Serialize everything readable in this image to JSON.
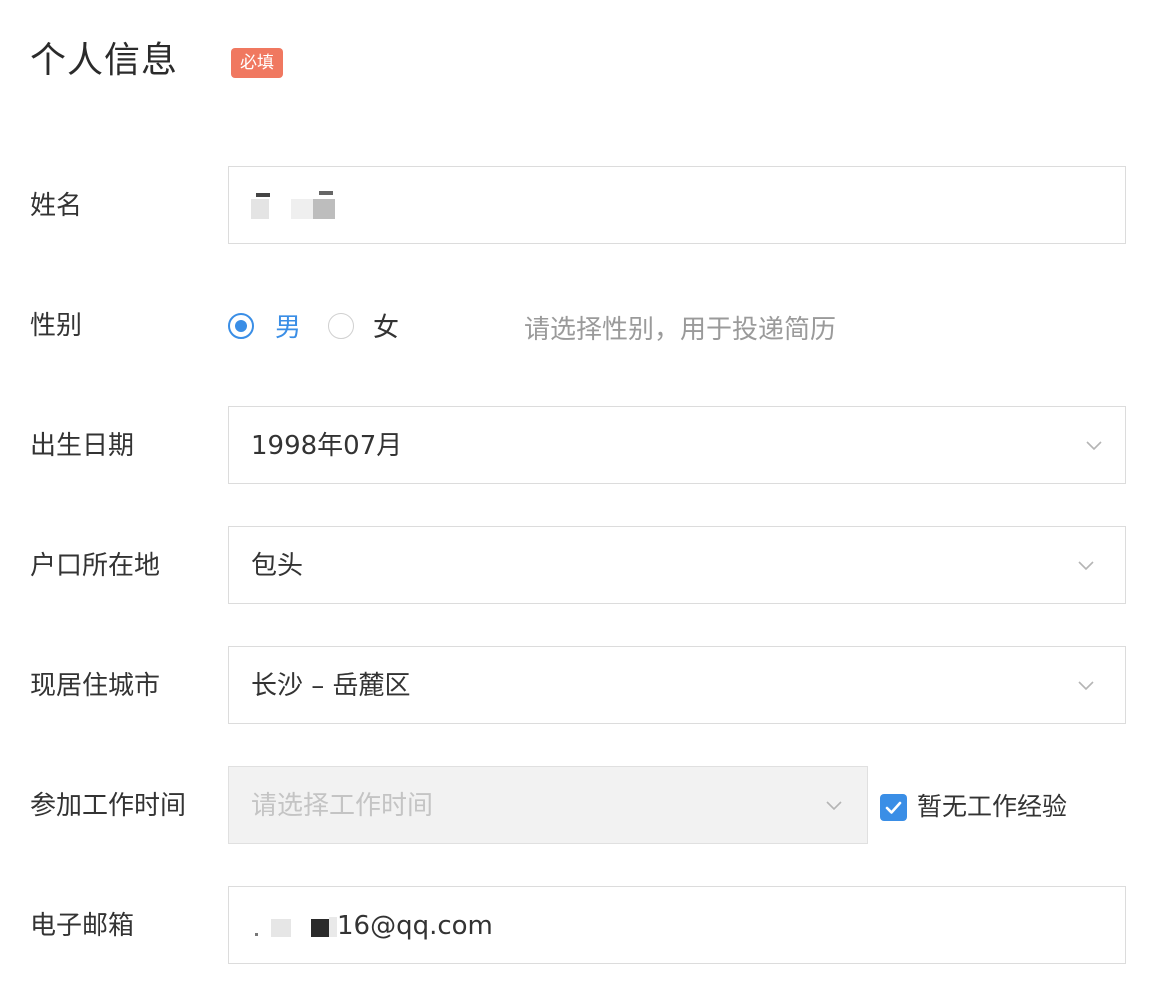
{
  "section": {
    "title": "个人信息",
    "required_badge": "必填"
  },
  "fields": {
    "name": {
      "label": "姓名",
      "value": ""
    },
    "gender": {
      "label": "性别",
      "options": [
        "男",
        "女"
      ],
      "selected": "男",
      "hint": "请选择性别，用于投递简历"
    },
    "birth_date": {
      "label": "出生日期",
      "value": "1998年07月"
    },
    "hukou": {
      "label": "户口所在地",
      "value": "包头"
    },
    "current_city": {
      "label": "现居住城市",
      "value": "长沙 – 岳麓区"
    },
    "work_start": {
      "label": "参加工作时间",
      "placeholder": "请选择工作时间",
      "disabled": true,
      "no_experience_label": "暂无工作经验",
      "no_experience_checked": true
    },
    "email": {
      "label": "电子邮箱",
      "value_suffix": "16@qq.com"
    }
  },
  "colors": {
    "accent": "#3a8ee6",
    "badge": "#f07860",
    "hint": "#9a9a9a",
    "disabled_bg": "#f2f2f2"
  },
  "icons": {
    "dropdown": "chevron-down-icon",
    "checkbox": "checkmark-icon"
  }
}
